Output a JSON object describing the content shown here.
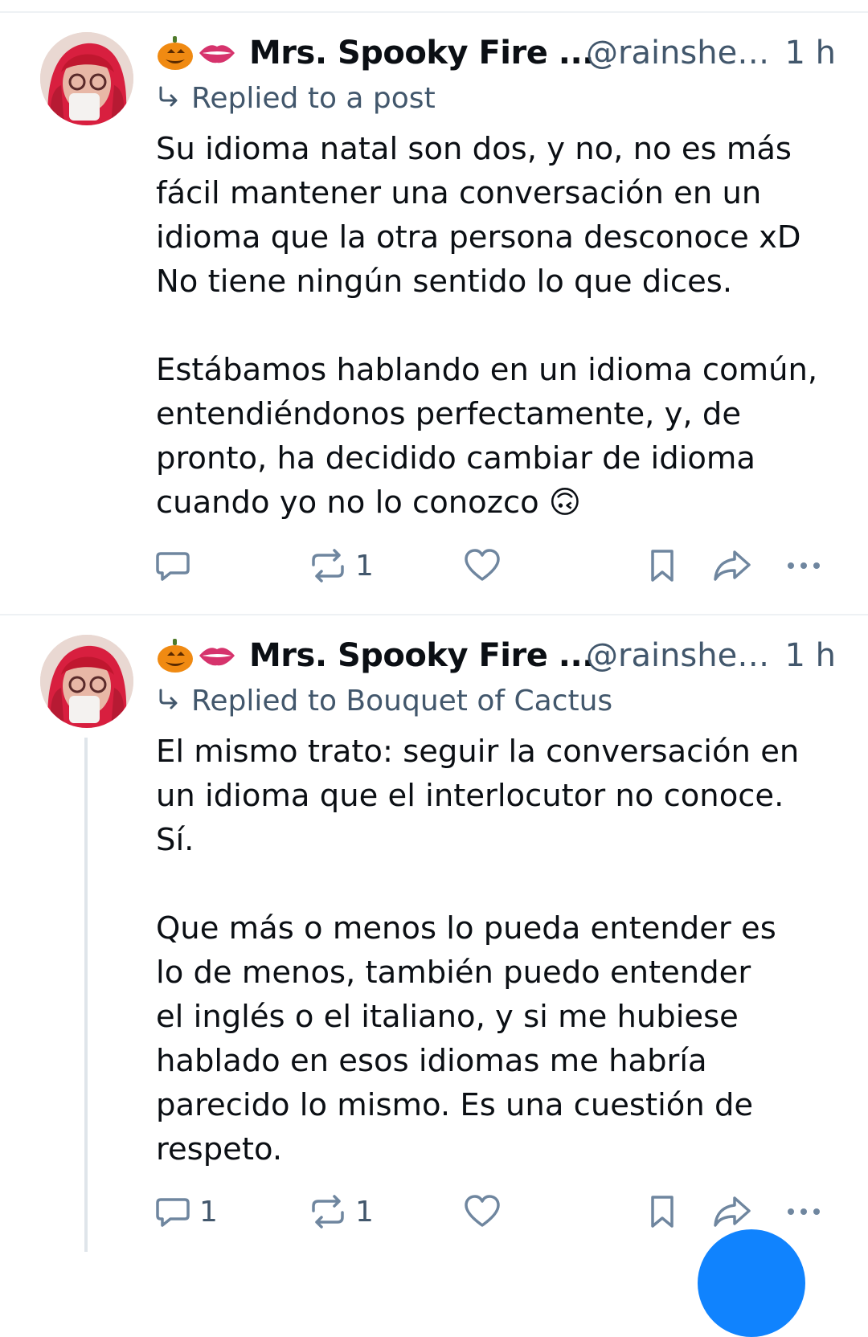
{
  "posts": [
    {
      "author_name": "Mrs. Spooky Fire ...",
      "handle": "@rainshep...",
      "time": "1 h",
      "reply_label": "Replied to a post",
      "paragraphs": [
        "Su idioma natal son dos, y no, no es más\nfácil mantener una conversación en un\nidioma que la otra persona desconoce xD\nNo tiene ningún sentido lo que dices.",
        "Estábamos hablando en un idioma común,\nentendiéndonos perfectamente, y, de\npronto, ha decidido cambiar de idioma\ncuando yo no lo conozco 🙃"
      ],
      "reply_count": "",
      "repost_count": "1"
    },
    {
      "author_name": "Mrs. Spooky Fire ...",
      "handle": "@rainshep...",
      "time": "1 h",
      "reply_label": "Replied to Bouquet of Cactus",
      "paragraphs": [
        "El mismo trato: seguir la conversación en\nun idioma que el interlocutor no conoce.\nSí.",
        "Que más o menos lo pueda entender es\nlo de menos, también puedo entender\nel inglés o el italiano, y si me hubiese\nhablado en esos idiomas me habría\nparecido lo mismo. Es una cuestión de\nrespeto."
      ],
      "reply_count": "1",
      "repost_count": "1"
    }
  ],
  "icons": {
    "name_emojis": [
      "jack-o-lantern",
      "lips"
    ],
    "actions": [
      "reply-icon",
      "repost-icon",
      "like-icon",
      "bookmark-icon",
      "share-icon",
      "more-icon"
    ]
  },
  "colors": {
    "text": "#0b0f14",
    "muted": "#42576c",
    "icon": "#6f869f",
    "fab": "#1083fe"
  }
}
